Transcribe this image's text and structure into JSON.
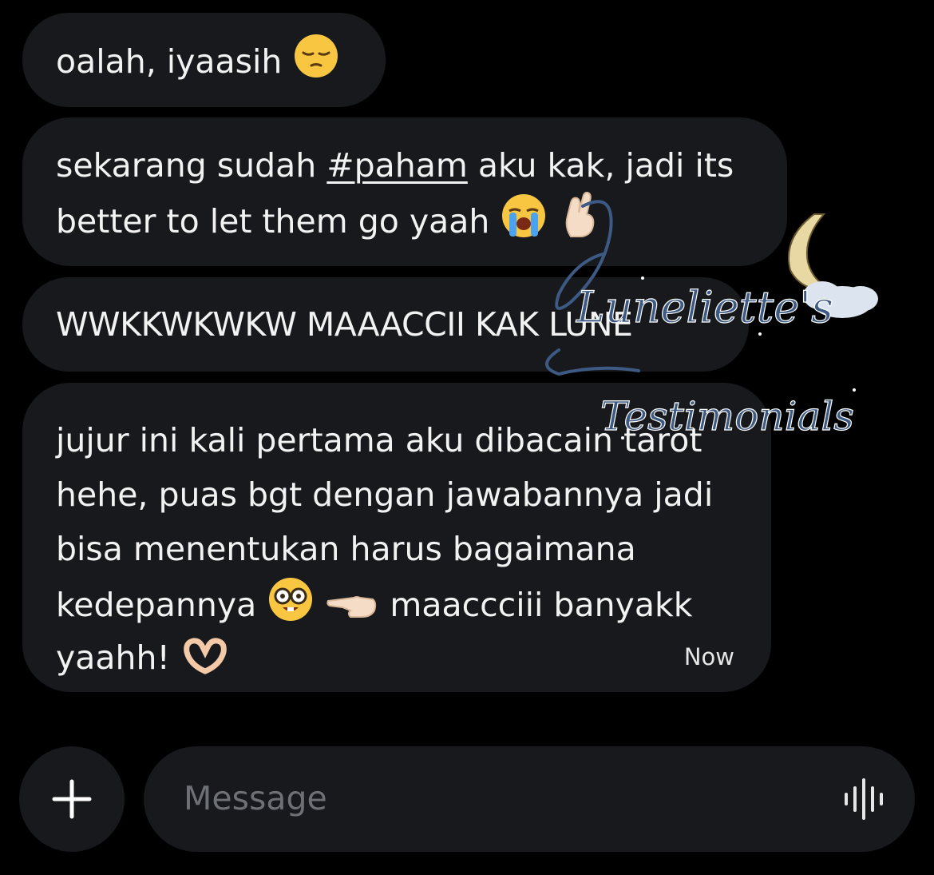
{
  "messages": [
    {
      "text": "oalah, iyaasih",
      "emoji": "pensive-face"
    },
    {
      "text_before": "sekarang sudah ",
      "hashtag": "#paham",
      "text_after": " aku kak, jadi its",
      "line2": "better to let them go yaah",
      "emojis": [
        "loudly-crying-face",
        "hand-with-index-finger-and-thumb-crossed"
      ]
    },
    {
      "text": "WWKKWKWKW MAAACCII KAK LUNE"
    },
    {
      "lines": [
        "jujur ini kali pertama aku dibacain tarot",
        "hehe, puas bgt dengan jawabannya jadi",
        "bisa menentukan harus bagaimana",
        "kedepannya",
        "maaccciii banyakk",
        "yaahh!"
      ],
      "emojis": [
        "nerd-face",
        "left-pointing-hand",
        "heart-hands"
      ],
      "timestamp": "Now"
    }
  ],
  "composer": {
    "placeholder": "Message",
    "add_icon": "plus-icon",
    "voice_icon": "voice-waveform-icon"
  },
  "watermark": {
    "line1": "Luneliette's",
    "line2": "Testimonials",
    "icon": "crescent-moon-cloud-icon"
  },
  "colors": {
    "background": "#000000",
    "bubble": "#18191c",
    "text": "#f2f2f2",
    "placeholder": "#6d7075",
    "watermark": "#3d5a84"
  }
}
